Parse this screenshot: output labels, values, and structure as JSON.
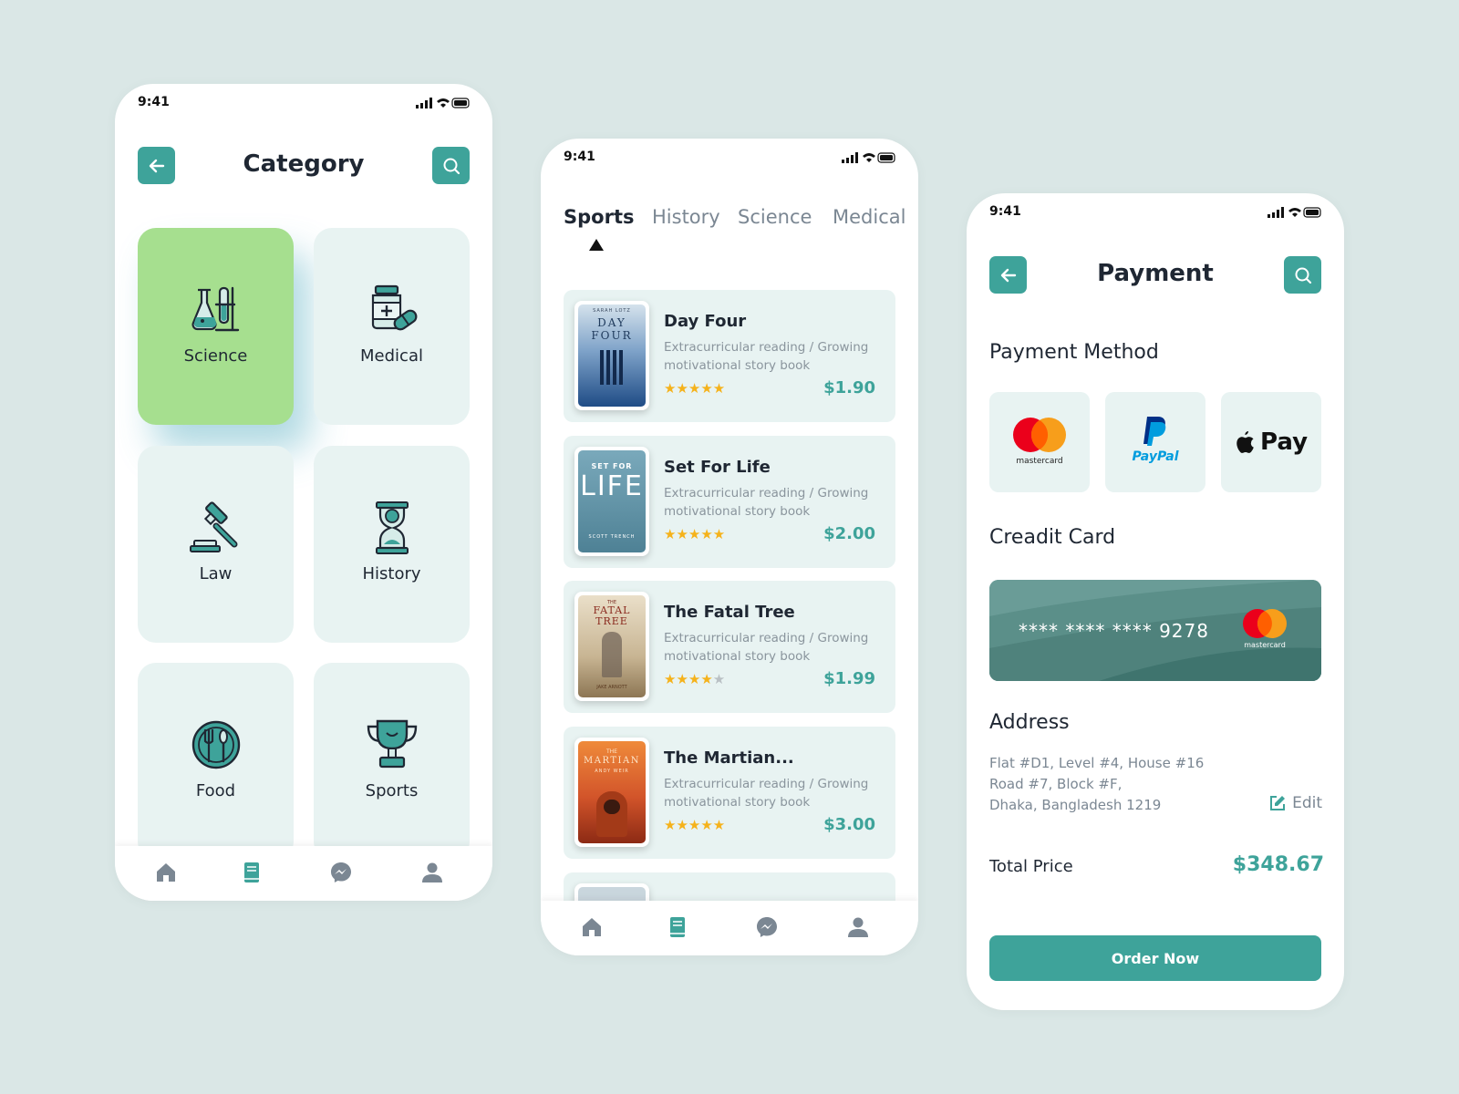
{
  "status_bar": {
    "time": "9:41"
  },
  "category_screen": {
    "title": "Category",
    "categories": [
      {
        "label": "Science",
        "icon": "science-flask-icon",
        "active": true
      },
      {
        "label": "Medical",
        "icon": "medicine-bottle-icon",
        "active": false
      },
      {
        "label": "Law",
        "icon": "gavel-icon",
        "active": false
      },
      {
        "label": "History",
        "icon": "hourglass-icon",
        "active": false
      },
      {
        "label": "Food",
        "icon": "plate-cutlery-icon",
        "active": false
      },
      {
        "label": "Sports",
        "icon": "trophy-icon",
        "active": false
      }
    ]
  },
  "bottom_nav": {
    "items": [
      {
        "icon": "home-icon",
        "active": false
      },
      {
        "icon": "book-icon",
        "active": true
      },
      {
        "icon": "messenger-icon",
        "active": false
      },
      {
        "icon": "profile-icon",
        "active": false
      }
    ]
  },
  "book_list_screen": {
    "tabs": [
      {
        "label": "Sports",
        "active": true
      },
      {
        "label": "History",
        "active": false
      },
      {
        "label": "Science",
        "active": false
      },
      {
        "label": "Medical",
        "active": false
      }
    ],
    "books": [
      {
        "title": "Day Four",
        "description": "Extracurricular reading / Growing motivational story book",
        "rating": 5,
        "price": "$1.90",
        "cover": {
          "top_text": "SARAH LOTZ",
          "title_text": "DAY FOUR",
          "colors": [
            "#c9d8e6",
            "#2e5f9b"
          ]
        }
      },
      {
        "title": "Set For Life",
        "description": "Extracurricular reading / Growing motivational story book",
        "rating": 5,
        "price": "$2.00",
        "cover": {
          "top_text": "SET FOR",
          "title_text": "LIFE",
          "author_text": "SCOTT TRENCH",
          "colors": [
            "#6e9fb0",
            "#4f8295"
          ]
        }
      },
      {
        "title": "The Fatal Tree",
        "description": "Extracurricular reading / Growing motivational story book",
        "rating": 4,
        "price": "$1.99",
        "cover": {
          "top_text": "THE",
          "title_text": "FATAL TREE",
          "author_text": "JAKE ARNOTT",
          "colors": [
            "#e6dcc6",
            "#b59e7c"
          ]
        }
      },
      {
        "title": "The Martian...",
        "description": "Extracurricular reading / Growing motivational story book",
        "rating": 5,
        "price": "$3.00",
        "cover": {
          "top_text": "THE",
          "title_text": "MARTIAN",
          "author_text": "ANDY WEIR",
          "colors": [
            "#e2722e",
            "#b53f1d"
          ]
        }
      }
    ]
  },
  "payment_screen": {
    "title": "Payment",
    "payment_method_heading": "Payment Method",
    "methods": [
      {
        "name": "mastercard",
        "icon": "mastercard-logo"
      },
      {
        "name": "PayPal",
        "icon": "paypal-logo"
      },
      {
        "name": "Pay",
        "icon": "apple-logo"
      }
    ],
    "credit_card_heading": "Creadit Card",
    "card": {
      "masked_number": "****  ****  ****  9278",
      "brand": "mastercard"
    },
    "address_heading": "Address",
    "address_lines": [
      "Flat #D1, Level #4, House #16",
      "Road #7, Block #F,",
      "Dhaka, Bangladesh 1219"
    ],
    "edit_label": "Edit",
    "total_label": "Total Price",
    "total_value": "$348.67",
    "order_button": "Order Now"
  },
  "colors": {
    "accent": "#3ea39a",
    "active_card": "#a6df8f",
    "card_bg": "#e8f3f2",
    "page_bg": "#dae7e6",
    "star": "#f5b21b"
  }
}
